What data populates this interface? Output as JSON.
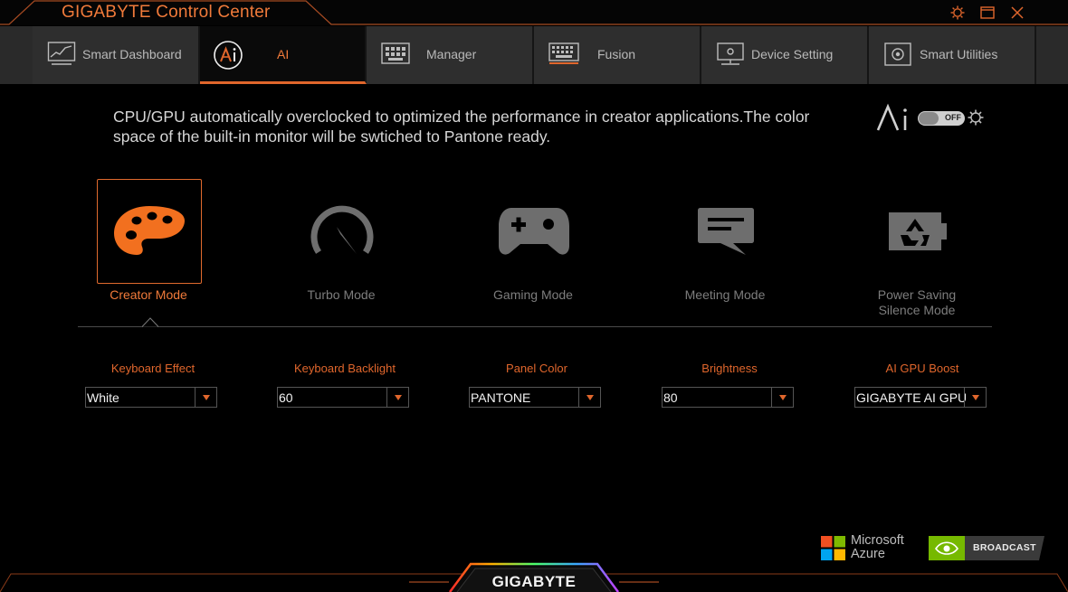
{
  "app": {
    "title": "GIGABYTE Control Center"
  },
  "tabs": [
    {
      "label": "Smart Dashboard",
      "icon": "dashboard-icon",
      "active": false
    },
    {
      "label": "AI",
      "icon": "ai-icon",
      "active": true
    },
    {
      "label": "Manager",
      "icon": "manager-icon",
      "active": false
    },
    {
      "label": "Fusion",
      "icon": "keyboard-icon",
      "active": false
    },
    {
      "label": "Device Setting",
      "icon": "monitor-icon",
      "active": false
    },
    {
      "label": "Smart Utilities",
      "icon": "utilities-icon",
      "active": false
    }
  ],
  "ai": {
    "description": "CPU/GPU automatically overclocked to optimized the performance in creator applications.The color space of the built-in monitor will be swtiched to Pantone ready.",
    "toggle_state": "OFF"
  },
  "modes": [
    {
      "label": "Creator Mode",
      "icon": "palette-icon",
      "selected": true
    },
    {
      "label": "Turbo Mode",
      "icon": "speedometer-icon",
      "selected": false
    },
    {
      "label": "Gaming Mode",
      "icon": "gamepad-icon",
      "selected": false
    },
    {
      "label": "Meeting Mode",
      "icon": "chat-bubble-icon",
      "selected": false
    },
    {
      "label": "Power Saving\nSilence Mode",
      "icon": "battery-recycle-icon",
      "selected": false
    }
  ],
  "settings": [
    {
      "label": "Keyboard Effect",
      "value": "White"
    },
    {
      "label": "Keyboard Backlight",
      "value": "60"
    },
    {
      "label": "Panel Color",
      "value": "PANTONE"
    },
    {
      "label": "Brightness",
      "value": "80"
    },
    {
      "label": "AI GPU Boost",
      "value": "GIGABYTE AI GPU"
    }
  ],
  "footer": {
    "azure_line1": "Microsoft",
    "azure_line2": "Azure",
    "nvidia_label": "BROADCAST",
    "brand": "GIGABYTE"
  },
  "colors": {
    "accent": "#e0662c",
    "background": "#000000",
    "tab_bg": "#2e2e2e"
  }
}
